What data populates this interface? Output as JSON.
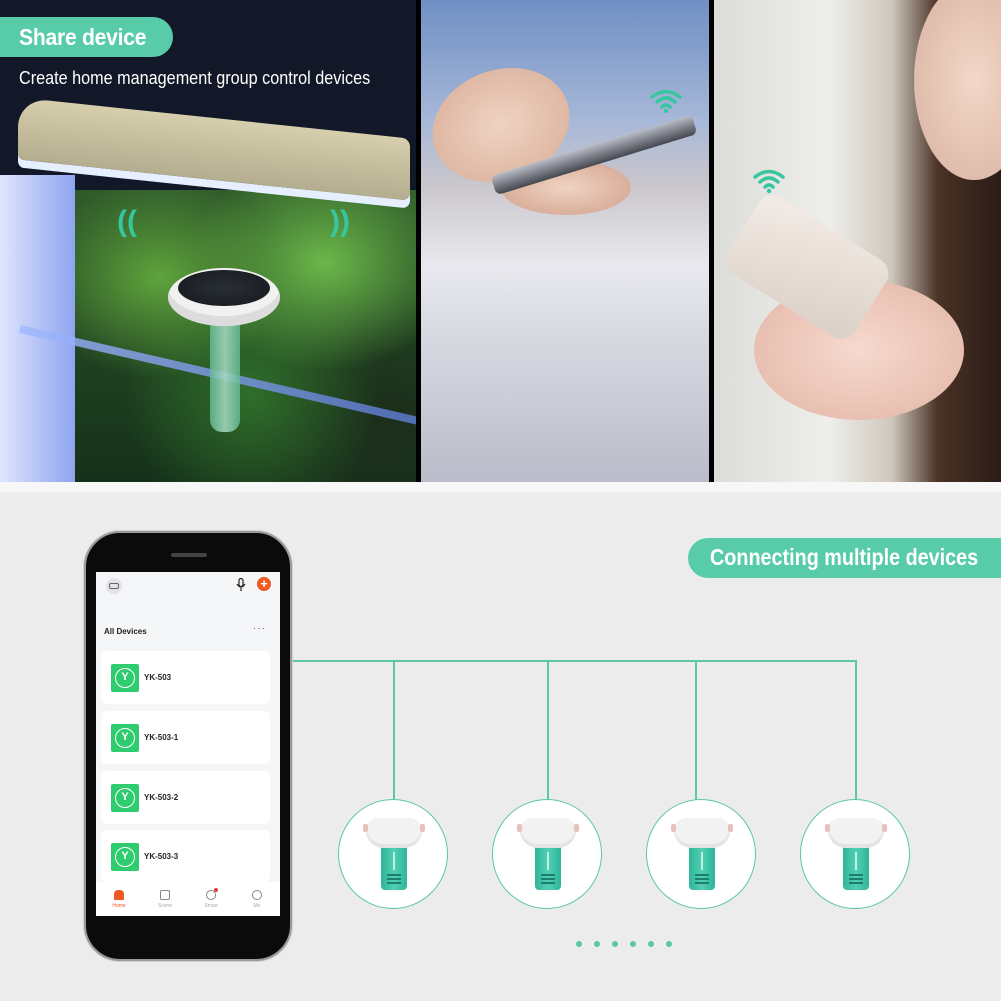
{
  "header": {
    "share_banner": "Share device",
    "share_subtitle": "Create home management group control devices"
  },
  "connect_banner": "Connecting multiple devices",
  "colors": {
    "accent": "#58cca8",
    "line": "#5cc7a6",
    "app_orange": "#ef5a23",
    "device_green": "#2ecc6f",
    "background": "#ececec"
  },
  "photos": [
    {
      "name": "aquarium-scene",
      "icon": "wifi-signal-icon"
    },
    {
      "name": "hands-with-phone-scene",
      "icon": "wifi-icon"
    },
    {
      "name": "woman-with-phone-scene",
      "icon": "wifi-icon"
    }
  ],
  "app": {
    "top_icons": [
      "home-icon",
      "microphone-icon",
      "add-icon"
    ],
    "add_symbol": "+",
    "section_title": "All Devices",
    "more_symbol": "···",
    "devices": [
      {
        "name": "YK-503",
        "icon": "water-sensor-icon",
        "glyph": "Y"
      },
      {
        "name": "YK-503-1",
        "icon": "water-sensor-icon",
        "glyph": "Y"
      },
      {
        "name": "YK-503-2",
        "icon": "water-sensor-icon",
        "glyph": "Y"
      },
      {
        "name": "YK-503-3",
        "icon": "water-sensor-icon",
        "glyph": "Y"
      }
    ],
    "tabs": [
      {
        "label": "Home",
        "icon": "home-icon",
        "active": true
      },
      {
        "label": "Scene",
        "icon": "scene-icon",
        "active": false
      },
      {
        "label": "Smart",
        "icon": "smart-icon",
        "active": false,
        "badge": true
      },
      {
        "label": "Me",
        "icon": "profile-icon",
        "active": false
      }
    ]
  },
  "network": {
    "connected_devices": 4,
    "more_indicator_dots": 6
  }
}
